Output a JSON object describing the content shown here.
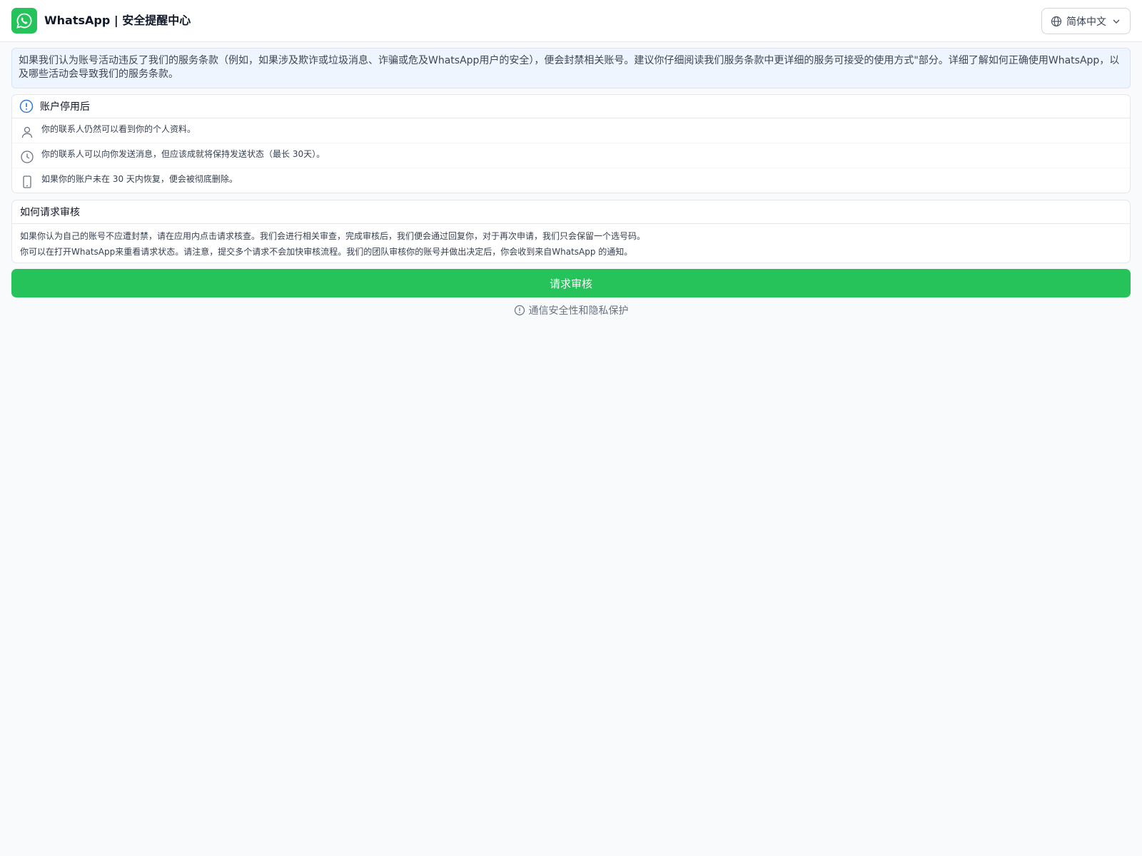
{
  "header": {
    "brand": "WhatsApp | 安全提醒中心",
    "language": "简体中文",
    "logo_icon": "whatsapp-logo-icon"
  },
  "notice": {
    "text": "如果我们认为账号活动违反了我们的服务条款（例如，如果涉及欺诈或垃圾消息、诈骗或危及WhatsApp用户的安全），便会封禁相关账号。建议你仔细阅读我们服务条款中更详细的服务可接受的使用方式\"部分。详细了解如何正确使用WhatsApp，以及哪些活动会导致我们的服务条款。"
  },
  "after_disable": {
    "title": "账户停用后",
    "items": [
      {
        "icon": "person-icon",
        "text": "你的联系人仍然可以看到你的个人资料。"
      },
      {
        "icon": "clock-icon",
        "text": "你的联系人可以向你发送消息，但应该成就将保持发送状态（最长 30天）。"
      },
      {
        "icon": "phone-icon",
        "text": "如果你的账户未在 30 天内恢复，便会被彻底删除。"
      }
    ]
  },
  "review": {
    "title": "如何请求审核",
    "line1": "如果你认为自己的账号不应遭封禁，请在应用内点击请求核查。我们会进行相关审查，完成审核后，我们便会通过回复你，对于再次申请，我们只会保留一个选号码。",
    "line2": "你可以在打开WhatsApp来重看请求状态。请注意，提交多个请求不会加快审核流程。我们的团队审核你的账号并做出决定后，你会收到来自WhatsApp 的通知。"
  },
  "cta": {
    "label": "请求审核"
  },
  "footer": {
    "text": "通信安全性和隐私保护"
  },
  "colors": {
    "brand_green": "#25c35a",
    "info_blue": "#2f7dd1",
    "notice_bg": "#eef5ff"
  }
}
